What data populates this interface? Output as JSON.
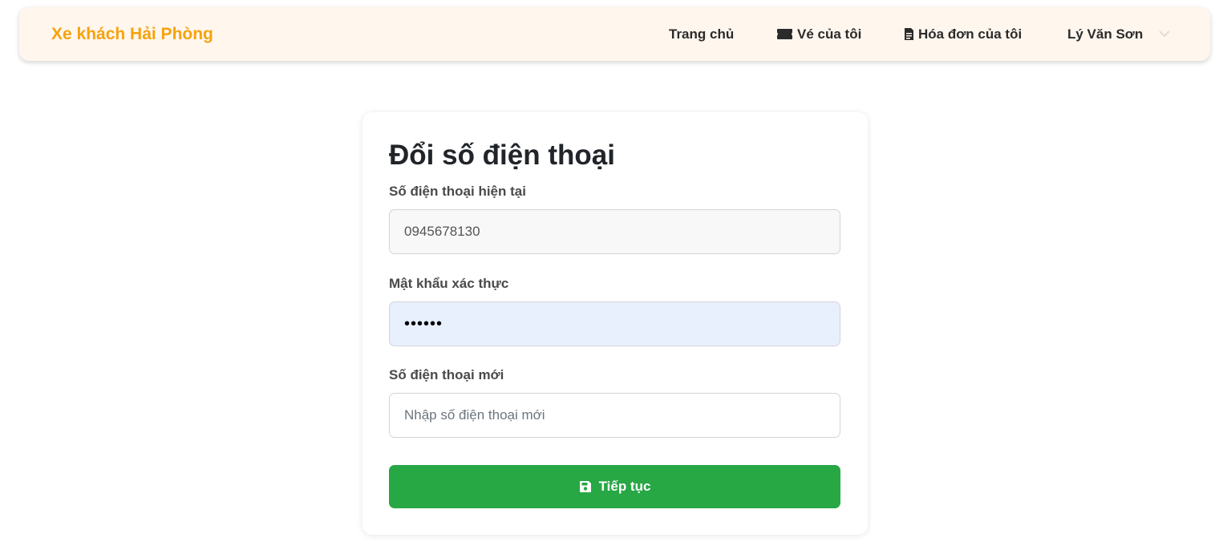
{
  "navbar": {
    "brand": "Xe khách Hải Phòng",
    "brand_color": "#f5a30d",
    "items": [
      {
        "label": "Trang chủ"
      },
      {
        "label": "Vé của tôi",
        "icon": "ticket-icon"
      },
      {
        "label": "Hóa đơn của tôi",
        "icon": "invoice-icon"
      }
    ],
    "user": {
      "name": "Lý Văn Sơn",
      "icon": "chevron-down-icon"
    }
  },
  "form": {
    "title": "Đổi số điện thoại",
    "current_phone": {
      "label": "Số điện thoại hiện tại",
      "value": "0945678130"
    },
    "password": {
      "label": "Mật khẩu xác thực",
      "value": "••••••"
    },
    "new_phone": {
      "label": "Số điện thoại mới",
      "placeholder": "Nhập số điện thoại mới",
      "value": ""
    },
    "submit": {
      "label": "Tiếp tục",
      "icon": "save-icon",
      "color": "#28a745"
    }
  }
}
